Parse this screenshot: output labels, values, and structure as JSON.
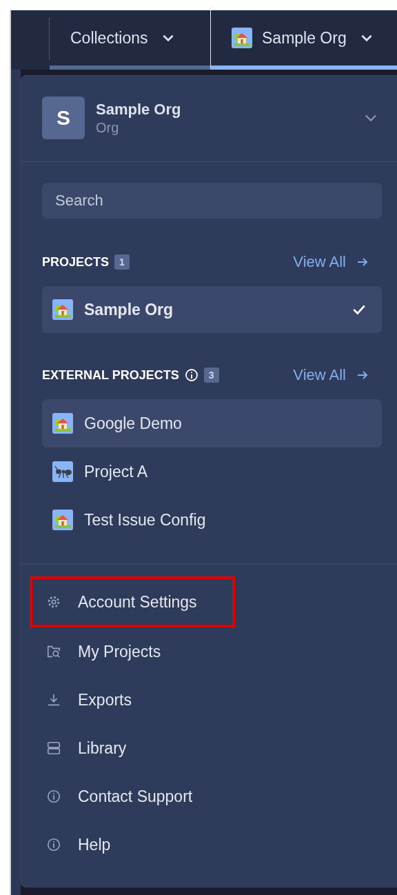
{
  "top_bar": {
    "tabs": [
      {
        "label": "Collections",
        "selected": false
      },
      {
        "label": "Sample Org",
        "selected": true
      }
    ]
  },
  "org_header": {
    "initial": "S",
    "name": "Sample Org",
    "type": "Org"
  },
  "search": {
    "placeholder": "Search"
  },
  "projects": {
    "title": "PROJECTS",
    "count": "1",
    "view_all": "View All",
    "items": [
      {
        "name": "Sample Org",
        "selected": true
      }
    ]
  },
  "external_projects": {
    "title": "EXTERNAL PROJECTS",
    "count": "3",
    "view_all": "View All",
    "items": [
      {
        "name": "Google Demo",
        "hovered": true
      },
      {
        "name": "Project A",
        "hovered": false
      },
      {
        "name": "Test Issue Config",
        "hovered": false
      }
    ]
  },
  "menu": [
    {
      "label": "Account Settings",
      "highlighted": true
    },
    {
      "label": "My Projects",
      "highlighted": false
    },
    {
      "label": "Exports",
      "highlighted": false
    },
    {
      "label": "Library",
      "highlighted": false
    },
    {
      "label": "Contact Support",
      "highlighted": false
    },
    {
      "label": "Help",
      "highlighted": false
    }
  ]
}
